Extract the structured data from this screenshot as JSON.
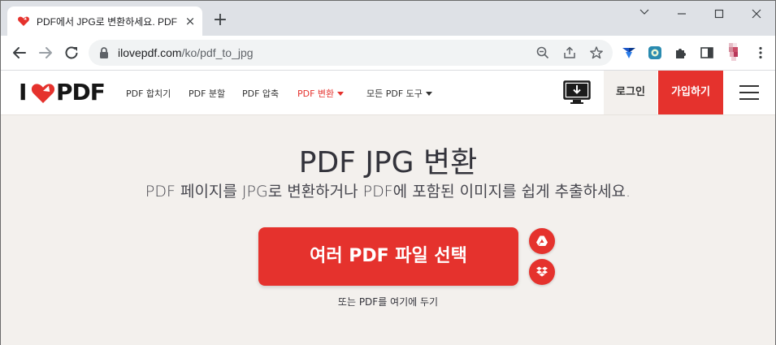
{
  "browser": {
    "tab": {
      "title": "PDF에서 JPG로 변환하세요. PDF",
      "close": "×"
    },
    "new_tab": "+",
    "url": {
      "domain": "ilovepdf.com",
      "path": "/ko/pdf_to_jpg"
    }
  },
  "site": {
    "logo": {
      "left": "I",
      "right": "PDF"
    },
    "menu": [
      {
        "label": "PDF 합치기"
      },
      {
        "label": "PDF 분할"
      },
      {
        "label": "PDF 압축"
      },
      {
        "label": "PDF 변환"
      },
      {
        "label": "모든 PDF 도구"
      }
    ],
    "login_label": "로그인",
    "signup_label": "가입하기"
  },
  "main": {
    "title": "PDF JPG 변환",
    "subtitle": "PDF 페이지를 JPG로 변환하거나 PDF에 포함된 이미지를 쉽게 추출하세요.",
    "select_button": "여러 PDF 파일 선택",
    "drop_hint": "또는 PDF를 여기에 두기"
  },
  "colors": {
    "brand_red": "#e5322d",
    "page_bg": "#f3f0ed",
    "text_dark": "#33333b"
  },
  "icons": [
    "heart-favicon",
    "close-icon",
    "plus-icon",
    "minimize-icon",
    "maximize-icon",
    "window-close-icon",
    "back-arrow-icon",
    "forward-arrow-icon",
    "reload-icon",
    "lock-icon",
    "zoom-icon",
    "share-icon",
    "star-icon",
    "extension-icon",
    "puzzle-icon",
    "side-panel-icon",
    "avatar",
    "kebab-menu-icon",
    "desktop-download-icon",
    "hamburger-menu-icon",
    "google-drive-icon",
    "dropbox-icon"
  ]
}
